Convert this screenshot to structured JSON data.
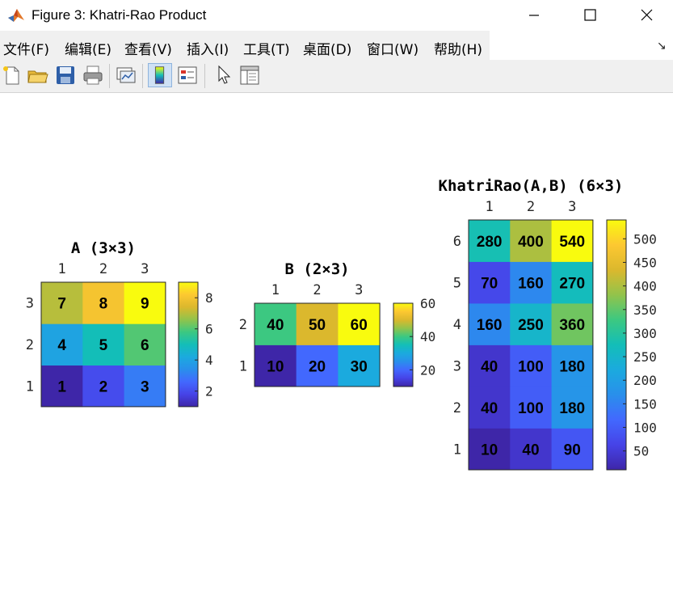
{
  "window": {
    "title": "Figure 3: Khatri-Rao Product"
  },
  "menu": [
    "文件(F)",
    "编辑(E)",
    "查看(V)",
    "插入(I)",
    "工具(T)",
    "桌面(D)",
    "窗口(W)",
    "帮助(H)"
  ],
  "toolbar": {
    "buttons": [
      "new-figure-icon",
      "open-file-icon",
      "save-icon",
      "print-icon",
      "link-plot-icon",
      "insert-colorbar-icon",
      "insert-legend-icon",
      "select-pointer-icon",
      "property-editor-icon"
    ]
  },
  "colormap": "parula",
  "chart_data": [
    {
      "type": "heatmap",
      "title": "A (3×3)",
      "xticks": [
        "1",
        "2",
        "3"
      ],
      "yticks": [
        "1",
        "2",
        "3"
      ],
      "rows_bottom_to_top": [
        [
          1,
          2,
          3
        ],
        [
          4,
          5,
          6
        ],
        [
          7,
          8,
          9
        ]
      ],
      "clim": [
        1,
        9
      ],
      "colorbar_ticks": [
        "2",
        "4",
        "6",
        "8"
      ]
    },
    {
      "type": "heatmap",
      "title": "B (2×3)",
      "xticks": [
        "1",
        "2",
        "3"
      ],
      "yticks": [
        "1",
        "2"
      ],
      "rows_bottom_to_top": [
        [
          10,
          20,
          30
        ],
        [
          40,
          50,
          60
        ]
      ],
      "clim": [
        10,
        60
      ],
      "colorbar_ticks": [
        "20",
        "40",
        "60"
      ]
    },
    {
      "type": "heatmap",
      "title": "KhatriRao(A,B) (6×3)",
      "xticks": [
        "1",
        "2",
        "3"
      ],
      "yticks": [
        "1",
        "2",
        "3",
        "4",
        "5",
        "6"
      ],
      "rows_bottom_to_top": [
        [
          10,
          40,
          90
        ],
        [
          40,
          100,
          180
        ],
        [
          40,
          100,
          180
        ],
        [
          160,
          250,
          360
        ],
        [
          70,
          160,
          270
        ],
        [
          280,
          400,
          540
        ]
      ],
      "clim": [
        10,
        540
      ],
      "colorbar_ticks": [
        "50",
        "100",
        "150",
        "200",
        "250",
        "300",
        "350",
        "400",
        "450",
        "500"
      ]
    }
  ]
}
